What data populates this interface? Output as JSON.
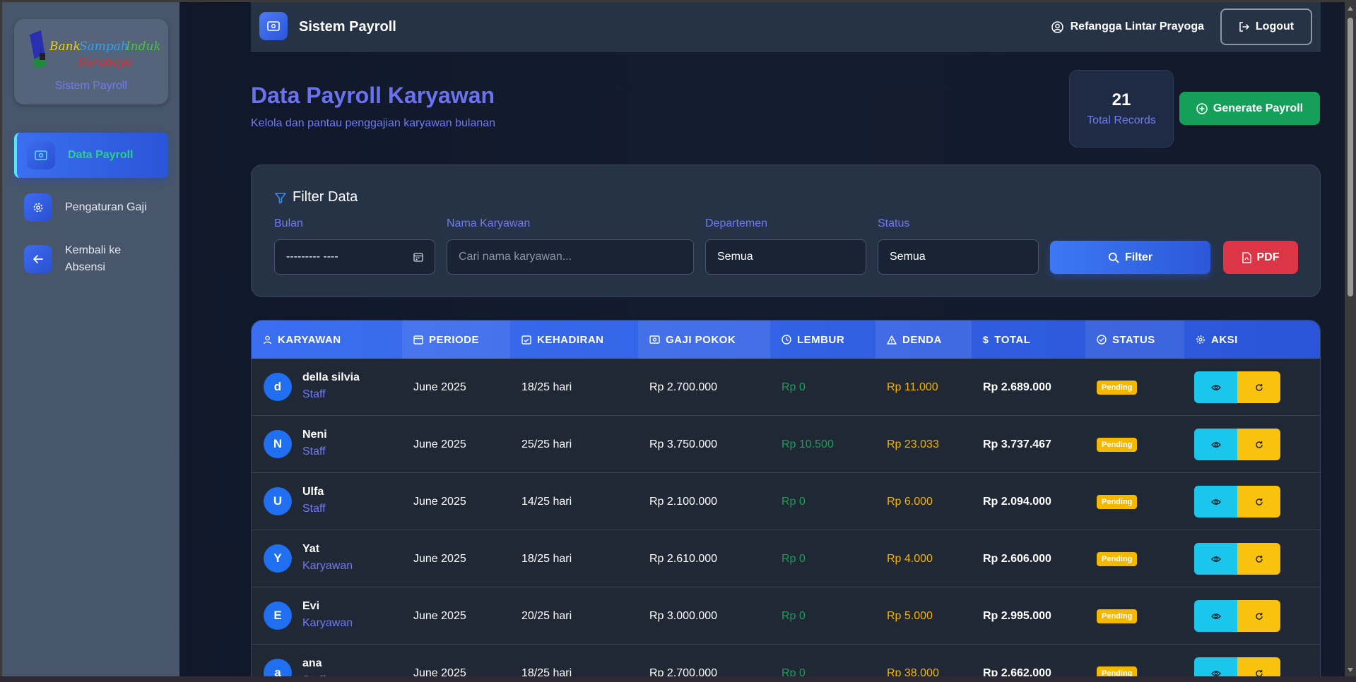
{
  "app": {
    "title": "Sistem Payroll",
    "logo_text": "Bank Sampah Induk Surabaya",
    "logo_subtitle": "Sistem Payroll"
  },
  "sidebar": {
    "items": [
      {
        "label": "Data Payroll",
        "icon": "money-icon",
        "active": true
      },
      {
        "label": "Pengaturan Gaji",
        "icon": "gear-icon",
        "active": false
      },
      {
        "label": "Kembali ke Absensi",
        "icon": "arrow-left-icon",
        "active": false
      }
    ]
  },
  "header": {
    "user_name": "Refangga Lintar Prayoga",
    "logout_label": "Logout"
  },
  "page": {
    "title": "Data Payroll Karyawan",
    "subtitle": "Kelola dan pantau penggajian karyawan bulanan",
    "records_count": "21",
    "records_label": "Total Records",
    "generate_label": "Generate Payroll"
  },
  "filter": {
    "title": "Filter Data",
    "bulan_label": "Bulan",
    "bulan_value": "--------- ----",
    "nama_label": "Nama Karyawan",
    "nama_placeholder": "Cari nama karyawan...",
    "departemen_label": "Departemen",
    "departemen_value": "Semua",
    "status_label": "Status",
    "status_value": "Semua",
    "filter_button": "Filter",
    "pdf_button": "PDF"
  },
  "table": {
    "columns": [
      "KARYAWAN",
      "PERIODE",
      "KEHADIRAN",
      "GAJI POKOK",
      "LEMBUR",
      "DENDA",
      "TOTAL",
      "STATUS",
      "AKSI"
    ],
    "rows": [
      {
        "initial": "d",
        "name": "della silvia",
        "role": "Staff",
        "periode": "June 2025",
        "kehadiran": "18/25 hari",
        "gaji": "Rp 2.700.000",
        "lembur": "Rp 0",
        "denda": "Rp 11.000",
        "total": "Rp 2.689.000",
        "status": "Pending"
      },
      {
        "initial": "N",
        "name": "Neni",
        "role": "Staff",
        "periode": "June 2025",
        "kehadiran": "25/25 hari",
        "gaji": "Rp 3.750.000",
        "lembur": "Rp 10.500",
        "denda": "Rp 23.033",
        "total": "Rp 3.737.467",
        "status": "Pending"
      },
      {
        "initial": "U",
        "name": "Ulfa",
        "role": "Staff",
        "periode": "June 2025",
        "kehadiran": "14/25 hari",
        "gaji": "Rp 2.100.000",
        "lembur": "Rp 0",
        "denda": "Rp 6.000",
        "total": "Rp 2.094.000",
        "status": "Pending"
      },
      {
        "initial": "Y",
        "name": "Yat",
        "role": "Karyawan",
        "periode": "June 2025",
        "kehadiran": "18/25 hari",
        "gaji": "Rp 2.610.000",
        "lembur": "Rp 0",
        "denda": "Rp 4.000",
        "total": "Rp 2.606.000",
        "status": "Pending"
      },
      {
        "initial": "E",
        "name": "Evi",
        "role": "Karyawan",
        "periode": "June 2025",
        "kehadiran": "20/25 hari",
        "gaji": "Rp 3.000.000",
        "lembur": "Rp 0",
        "denda": "Rp 5.000",
        "total": "Rp 2.995.000",
        "status": "Pending"
      },
      {
        "initial": "a",
        "name": "ana",
        "role": "Staff",
        "periode": "June 2025",
        "kehadiran": "18/25 hari",
        "gaji": "Rp 2.700.000",
        "lembur": "Rp 0",
        "denda": "Rp 38.000",
        "total": "Rp 2.662.000",
        "status": "Pending"
      }
    ]
  },
  "colors": {
    "accent": "#3b6ef0",
    "success": "#15a05a",
    "danger": "#dc3545",
    "warning": "#f5b800",
    "info": "#1ac6ec"
  }
}
